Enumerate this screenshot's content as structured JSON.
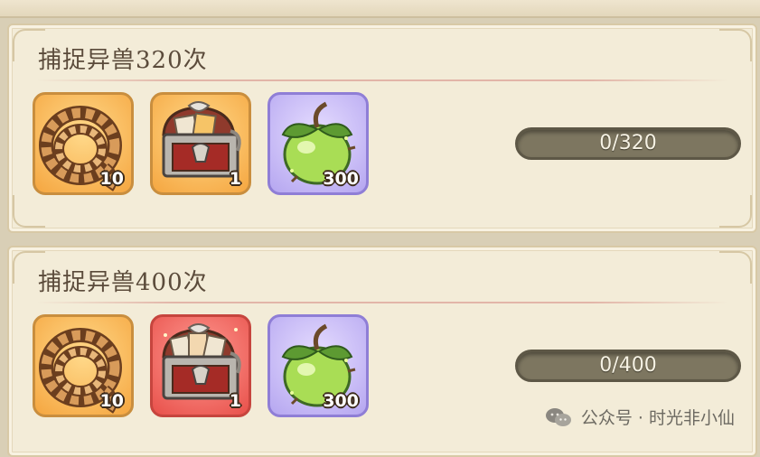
{
  "tasks": [
    {
      "title": "捕捉异兽320次",
      "rewards": [
        {
          "icon": "rope-lasso-icon",
          "qty": "10",
          "frame": "orange"
        },
        {
          "icon": "treasure-chest-icon",
          "qty": "1",
          "frame": "orange"
        },
        {
          "icon": "green-fruit-icon",
          "qty": "300",
          "frame": "purple"
        }
      ],
      "progress": {
        "text": "0/320",
        "current": 0,
        "total": 320
      }
    },
    {
      "title": "捕捉异兽400次",
      "rewards": [
        {
          "icon": "rope-lasso-icon",
          "qty": "10",
          "frame": "orange"
        },
        {
          "icon": "treasure-chest-icon",
          "qty": "1",
          "frame": "red"
        },
        {
          "icon": "green-fruit-icon",
          "qty": "300",
          "frame": "purple"
        }
      ],
      "progress": {
        "text": "0/400",
        "current": 0,
        "total": 400
      }
    }
  ],
  "watermark": {
    "text": "公众号 · 时光非小仙",
    "icon": "wechat-icon"
  },
  "colors": {
    "panel": "#f3ecd8",
    "title": "#5b4b3b",
    "progress_bar": "#7d7660"
  }
}
